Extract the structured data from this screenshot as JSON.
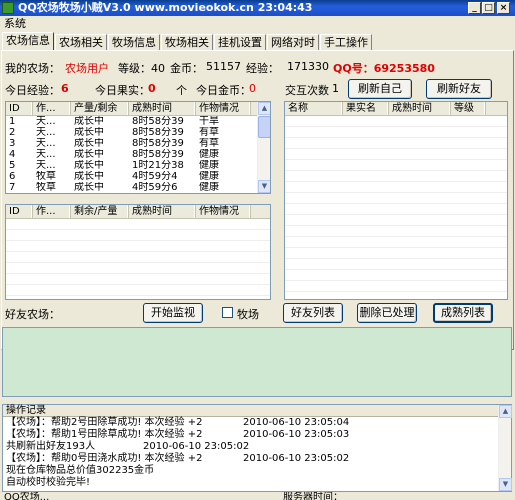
{
  "window": {
    "title": "QQ农场牧场小贼V3.0 www.movieokok.cn 23:04:43"
  },
  "menu": {
    "system": "系统"
  },
  "tabs": [
    "农场信息",
    "农场相关",
    "牧场信息",
    "牧场相关",
    "挂机设置",
    "网络对时",
    "手工操作"
  ],
  "farm": {
    "my_farm_label": "我的农场：",
    "user_type": "农场用户",
    "level_label": "等级：40",
    "gold_label": "金币：",
    "gold": "51157",
    "exp_label": "经验：",
    "exp": "171330",
    "qq_label": "QQ号：69253580",
    "today_exp_label": "今日经验：",
    "today_exp": "6",
    "today_fruit_label": "今日果实：",
    "today_fruit": "0",
    "unit_ge": "个",
    "today_gold_label": "今日金币：",
    "today_gold": "0",
    "interact_label": "交互次数",
    "interact_count": "1",
    "refresh_self": "刷新自己",
    "refresh_friends": "刷新好友"
  },
  "crops_table": {
    "headers": [
      "ID",
      "作...",
      "产量/剩余",
      "成熟时间",
      "作物情况"
    ],
    "rows": [
      [
        "1",
        "天...",
        "成长中",
        "8时58分39",
        "干旱"
      ],
      [
        "2",
        "天...",
        "成长中",
        "8时58分39",
        "有草"
      ],
      [
        "3",
        "天...",
        "成长中",
        "8时58分39",
        "有草"
      ],
      [
        "4",
        "天...",
        "成长中",
        "8时58分39",
        "健康"
      ],
      [
        "5",
        "天...",
        "成长中",
        "1时21分38",
        "健康"
      ],
      [
        "6",
        "牧草",
        "成长中",
        "4时59分4",
        "健康"
      ],
      [
        "7",
        "牧草",
        "成长中",
        "4时59分6",
        "健康"
      ]
    ]
  },
  "friend_crops_table": {
    "headers": [
      "ID",
      "作...",
      "剩余/产量",
      "成熟时间",
      "作物情况"
    ]
  },
  "friends_table": {
    "headers": [
      "名称",
      "果实名",
      "成熟时间",
      "等级"
    ]
  },
  "friend_farm": {
    "label": "好友农场：",
    "start_monitor": "开始监视",
    "pasture_label": "牧场",
    "friend_list": "好友列表",
    "delete_processed": "删除已处理",
    "mature_list": "成熟列表"
  },
  "log": {
    "title": "操作记录",
    "lines": [
      {
        "text": "【农场】：帮助2号田除草成功! 本次经验 +2",
        "time": "2010-06-10 23:05:04"
      },
      {
        "text": "【农场】：帮助1号田除草成功! 本次经验 +2",
        "time": "2010-06-10 23:05:03"
      },
      {
        "text": "共刷新出好友193人",
        "time": "2010-06-10 23:05:02",
        "offset": true
      },
      {
        "text": "【农场】：帮助0号田浇水成功! 本次经验 +2",
        "time": "2010-06-10 23:05:02"
      },
      {
        "text": "现在仓库物品总价值302235金币",
        "time": ""
      },
      {
        "text": "自动校时校验完毕!",
        "time": ""
      }
    ]
  },
  "status": {
    "left": "QQ农场...",
    "right": "服务器时间："
  }
}
